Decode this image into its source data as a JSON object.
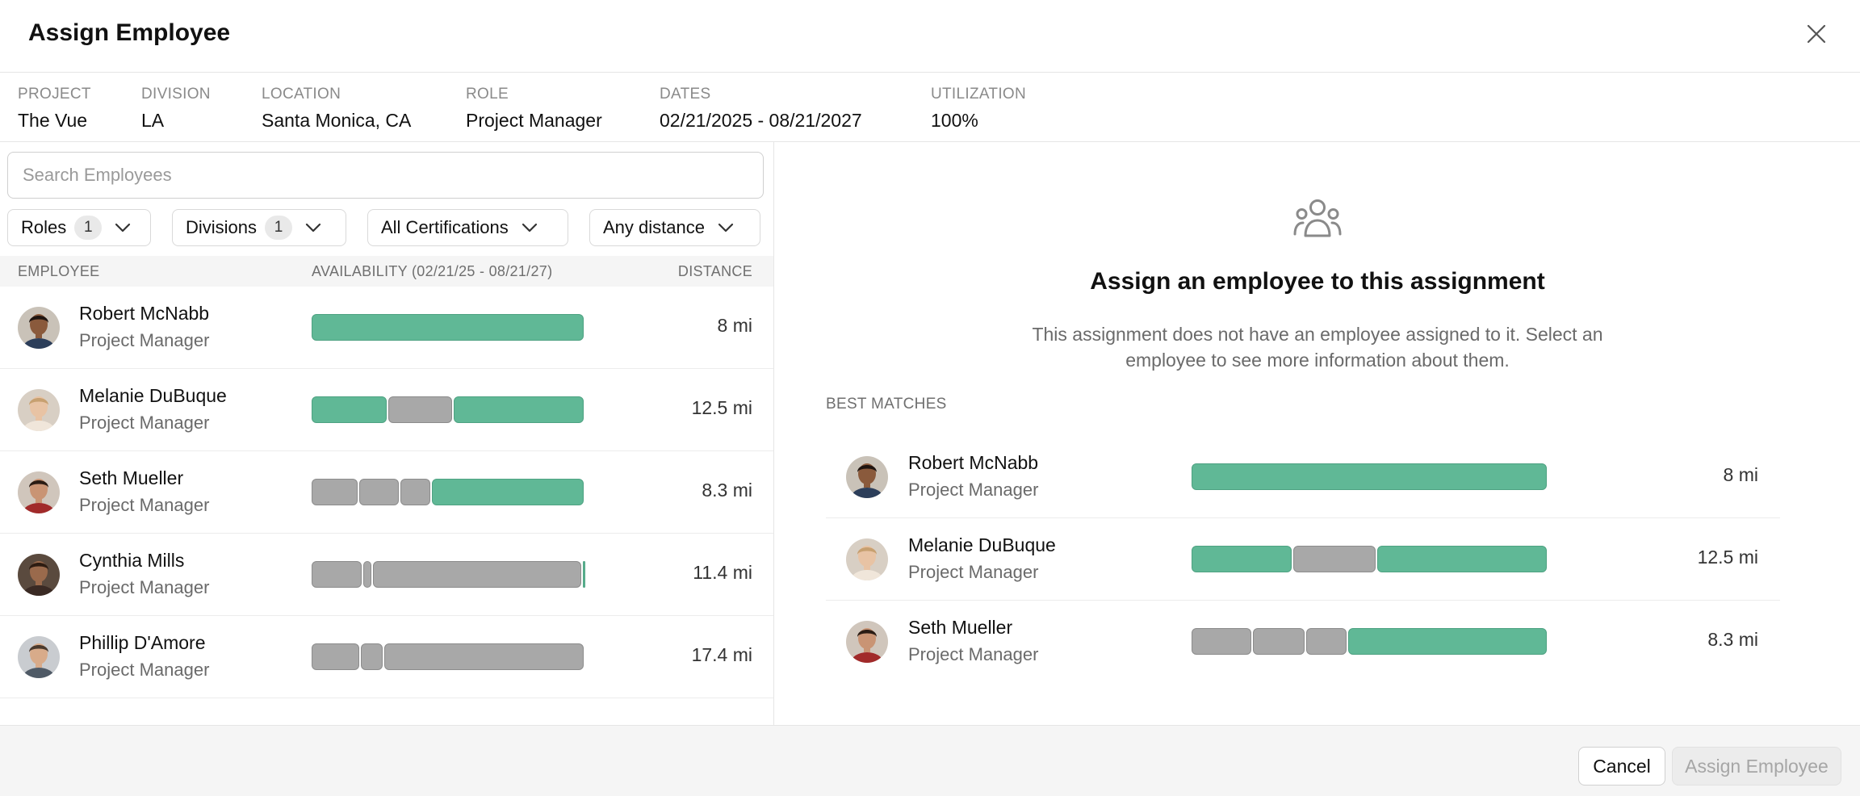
{
  "dialog": {
    "title": "Assign Employee"
  },
  "info": [
    {
      "label": "PROJECT",
      "value": "The Vue"
    },
    {
      "label": "DIVISION",
      "value": "LA"
    },
    {
      "label": "LOCATION",
      "value": "Santa Monica, CA"
    },
    {
      "label": "ROLE",
      "value": "Project Manager"
    },
    {
      "label": "DATES",
      "value": "02/21/2025 - 08/21/2027"
    },
    {
      "label": "UTILIZATION",
      "value": "100%"
    }
  ],
  "search": {
    "placeholder": "Search Employees",
    "value": ""
  },
  "filters": [
    {
      "label": "Roles",
      "count": "1"
    },
    {
      "label": "Divisions",
      "count": "1"
    },
    {
      "label": "All Certifications",
      "count": ""
    },
    {
      "label": "Any distance",
      "count": ""
    }
  ],
  "table": {
    "columns": {
      "employee": "EMPLOYEE",
      "availability": "AVAILABILITY (02/21/25 - 08/21/27)",
      "distance": "DISTANCE"
    }
  },
  "employees": [
    {
      "name": "Robert McNabb",
      "role": "Project Manager",
      "distance": "8 mi",
      "availability": [
        {
          "status": "available",
          "from": 0,
          "to": 1
        }
      ]
    },
    {
      "name": "Melanie DuBuque",
      "role": "Project Manager",
      "distance": "12.5 mi",
      "availability": [
        {
          "status": "available",
          "from": 0,
          "to": 0.28
        },
        {
          "status": "unavailable",
          "from": 0.28,
          "to": 0.52
        },
        {
          "status": "available",
          "from": 0.52,
          "to": 1
        }
      ]
    },
    {
      "name": "Seth Mueller",
      "role": "Project Manager",
      "distance": "8.3 mi",
      "availability": [
        {
          "status": "unavailable",
          "from": 0,
          "to": 0.175
        },
        {
          "status": "unavailable",
          "from": 0.175,
          "to": 0.325
        },
        {
          "status": "unavailable",
          "from": 0.325,
          "to": 0.44
        },
        {
          "status": "available",
          "from": 0.44,
          "to": 1
        }
      ]
    },
    {
      "name": "Cynthia Mills",
      "role": "Project Manager",
      "distance": "11.4 mi",
      "availability": [
        {
          "status": "unavailable",
          "from": 0,
          "to": 0.19
        },
        {
          "status": "unavailable",
          "from": 0.19,
          "to": 0.225
        },
        {
          "status": "unavailable",
          "from": 0.225,
          "to": 0.99
        },
        {
          "status": "available",
          "from": 0.99,
          "to": 1
        }
      ]
    },
    {
      "name": "Phillip D'Amore",
      "role": "Project Manager",
      "distance": "17.4 mi",
      "availability": [
        {
          "status": "unavailable",
          "from": 0,
          "to": 0.18
        },
        {
          "status": "unavailable",
          "from": 0.18,
          "to": 0.265
        },
        {
          "status": "unavailable",
          "from": 0.265,
          "to": 1
        }
      ]
    }
  ],
  "empty_state": {
    "icon": "people-icon",
    "title": "Assign an employee to this assignment",
    "description": "This assignment does not have an employee assigned to it. Select an employee to see more information about them."
  },
  "best_matches": {
    "label": "BEST MATCHES",
    "employees": [
      {
        "name": "Robert McNabb",
        "role": "Project Manager",
        "distance": "8 mi",
        "availability": [
          {
            "status": "available",
            "from": 0,
            "to": 1
          }
        ]
      },
      {
        "name": "Melanie DuBuque",
        "role": "Project Manager",
        "distance": "12.5 mi",
        "availability": [
          {
            "status": "available",
            "from": 0,
            "to": 0.285
          },
          {
            "status": "unavailable",
            "from": 0.285,
            "to": 0.52
          },
          {
            "status": "available",
            "from": 0.52,
            "to": 1
          }
        ]
      },
      {
        "name": "Seth Mueller",
        "role": "Project Manager",
        "distance": "8.3 mi",
        "availability": [
          {
            "status": "unavailable",
            "from": 0,
            "to": 0.172
          },
          {
            "status": "unavailable",
            "from": 0.172,
            "to": 0.322
          },
          {
            "status": "unavailable",
            "from": 0.322,
            "to": 0.44
          },
          {
            "status": "available",
            "from": 0.44,
            "to": 1
          }
        ]
      }
    ]
  },
  "footer": {
    "cancel_label": "Cancel",
    "assign_label": "Assign Employee"
  },
  "colors": {
    "available": "#60b896",
    "unavailable": "#a8a8a8",
    "assign_disabled_bg": "#ececec"
  }
}
